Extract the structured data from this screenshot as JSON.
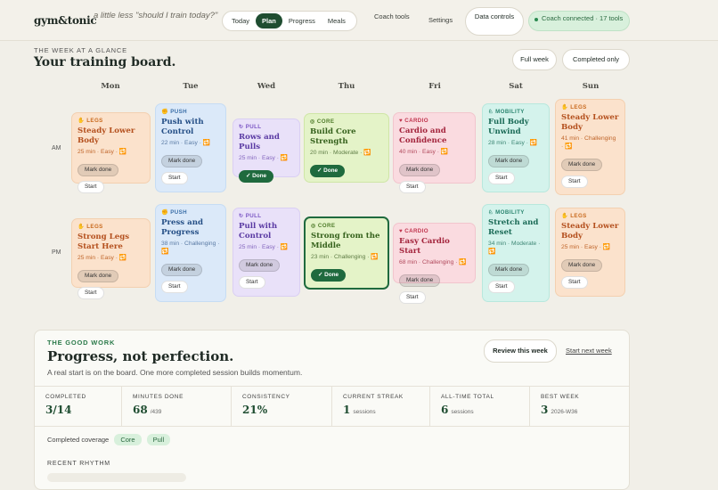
{
  "header": {
    "logo": "gym&tonic",
    "tagline": "a little less \"should I train today?\"",
    "tabs": [
      {
        "label": "Today",
        "active": false
      },
      {
        "label": "Plan",
        "active": true
      },
      {
        "label": "Progress",
        "active": false
      },
      {
        "label": "Meals",
        "active": false
      }
    ],
    "coach_tools": "Coach tools",
    "settings": "Settings",
    "data_controls": "Data controls",
    "coach_status": "Coach connected · 17 tools"
  },
  "board": {
    "eyebrow": "THE WEEK AT A GLANCE",
    "title": "Your training board.",
    "full_week": "Full week",
    "completed_only": "Completed only",
    "days": [
      "Mon",
      "Tue",
      "Wed",
      "Thu",
      "Fri",
      "Sat",
      "Sun"
    ],
    "rows": [
      "AM",
      "PM"
    ],
    "am": [
      {
        "cat": "LEGS",
        "icon": "flame-icon",
        "title": "Steady Lower Body",
        "meta": "25 min · Easy · 🔁",
        "actions": [
          "Mark done",
          "Start"
        ]
      },
      {
        "cat": "PUSH",
        "icon": "muscle-icon",
        "title": "Push with Control",
        "meta": "22 min · Easy · 🔁",
        "actions": [
          "Mark done",
          "Start"
        ]
      },
      {
        "cat": "PULL",
        "icon": "bolt-icon",
        "title": "Rows and Pulls",
        "meta": "25 min · Easy · 🔁",
        "actions": [
          "✓ Done"
        ]
      },
      {
        "cat": "CORE",
        "icon": "target-icon",
        "title": "Build Core Strength",
        "meta": "20 min · Moderate · 🔁",
        "actions": [
          "✓ Done"
        ]
      },
      {
        "cat": "CARDIO",
        "icon": "heart-icon",
        "title": "Cardio and Confidence",
        "meta": "40 min · Easy · 🔁",
        "actions": [
          "Mark done",
          "Start"
        ]
      },
      {
        "cat": "MOBILITY",
        "icon": "yoga-icon",
        "title": "Full Body Unwind",
        "meta": "28 min · Easy · 🔁",
        "actions": [
          "Mark done",
          "Start"
        ]
      },
      {
        "cat": "LEGS",
        "icon": "flame-icon",
        "title": "Steady Lower Body",
        "meta": "41 min · Challenging · 🔁",
        "actions": [
          "Mark done",
          "Start"
        ]
      }
    ],
    "pm": [
      {
        "cat": "LEGS",
        "icon": "flame-icon",
        "title": "Strong Legs Start Here",
        "meta": "25 min · Easy · 🔁",
        "actions": [
          "Mark done",
          "Start"
        ]
      },
      {
        "cat": "PUSH",
        "icon": "muscle-icon",
        "title": "Press and Progress",
        "meta": "38 min · Challenging · 🔁",
        "actions": [
          "Mark done",
          "Start"
        ]
      },
      {
        "cat": "PULL",
        "icon": "bolt-icon",
        "title": "Pull with Control",
        "meta": "25 min · Easy · 🔁",
        "actions": [
          "Mark done",
          "Start"
        ]
      },
      {
        "cat": "CORE",
        "icon": "target-icon",
        "title": "Strong from the Middle",
        "meta": "23 min · Challenging · 🔁",
        "actions": [
          "✓ Done"
        ]
      },
      {
        "cat": "CARDIO",
        "icon": "heart-icon",
        "title": "Easy Cardio Start",
        "meta": "68 min · Challenging · 🔁",
        "actions": [
          "Mark done",
          "Start"
        ]
      },
      {
        "cat": "MOBILITY",
        "icon": "yoga-icon",
        "title": "Stretch and Reset",
        "meta": "34 min · Moderate · 🔁",
        "actions": [
          "Mark done",
          "Start"
        ]
      },
      {
        "cat": "LEGS",
        "icon": "flame-icon",
        "title": "Steady Lower Body",
        "meta": "25 min · Easy · 🔁",
        "actions": [
          "Mark done",
          "Start"
        ]
      }
    ]
  },
  "progress": {
    "eyebrow": "THE GOOD WORK",
    "title": "Progress, not perfection.",
    "subtitle": "A real start is on the board. One more completed session builds momentum.",
    "review": "Review this week",
    "start_next": "Start next week",
    "stats": [
      {
        "label": "COMPLETED",
        "value": "3/14",
        "suffix": ""
      },
      {
        "label": "MINUTES DONE",
        "value": "68",
        "suffix": "/439"
      },
      {
        "label": "CONSISTENCY",
        "value": "21%",
        "suffix": ""
      },
      {
        "label": "CURRENT STREAK",
        "value": "1",
        "suffix": "sessions"
      },
      {
        "label": "ALL-TIME TOTAL",
        "value": "6",
        "suffix": "sessions"
      },
      {
        "label": "BEST WEEK",
        "value": "3",
        "suffix": "2026-W36"
      }
    ],
    "coverage_label": "Completed coverage",
    "coverage_tags": [
      "Core",
      "Pull"
    ],
    "rhythm_label": "RECENT RHYTHM"
  }
}
